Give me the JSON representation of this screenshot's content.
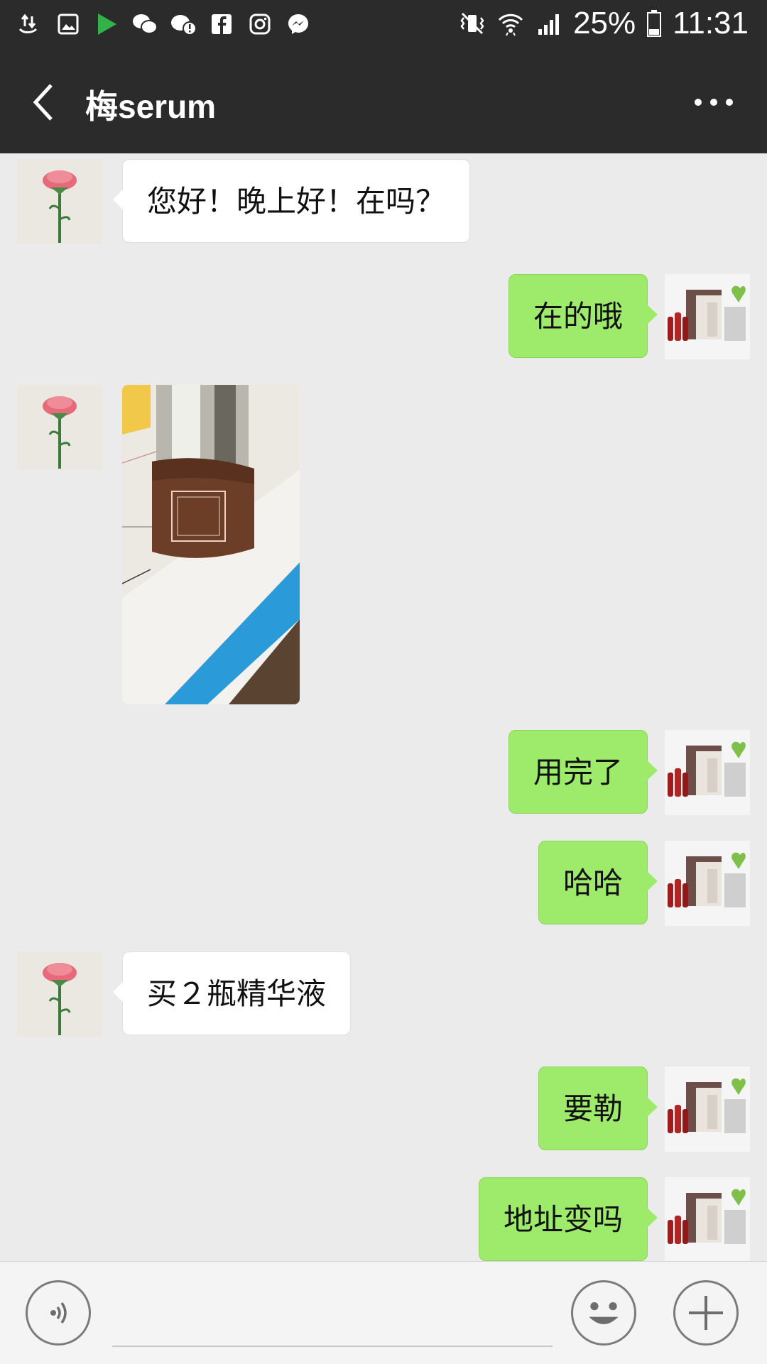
{
  "status_bar": {
    "battery_percent": "25%",
    "time": "11:31",
    "icons": [
      "usb-transfer-icon",
      "gallery-icon",
      "play-store-icon",
      "wechat-icon",
      "wechat-alert-icon",
      "facebook-icon",
      "instagram-icon",
      "messenger-icon",
      "mute-vibrate-icon",
      "wifi-icon",
      "signal-icon",
      "battery-icon"
    ]
  },
  "nav": {
    "title": "梅serum",
    "back_icon": "chevron-left-icon",
    "more_icon": "more-dots-icon"
  },
  "messages": [
    {
      "side": "in",
      "type": "text",
      "text": "您好！晚上好！在吗？"
    },
    {
      "side": "out",
      "type": "text",
      "text": "在的哦"
    },
    {
      "side": "in",
      "type": "image",
      "description": "product-bottle-photo"
    },
    {
      "side": "out",
      "type": "text",
      "text": "用完了"
    },
    {
      "side": "out",
      "type": "text",
      "text": "哈哈"
    },
    {
      "side": "in",
      "type": "text",
      "text": "买２瓶精华液"
    },
    {
      "side": "out",
      "type": "text",
      "text": "要勒"
    },
    {
      "side": "out",
      "type": "text",
      "text": "地址变吗"
    }
  ],
  "colors": {
    "header": "#2b2b2b",
    "chat_bg": "#ebebeb",
    "outgoing_bubble": "#9eea6a",
    "incoming_bubble": "#ffffff"
  },
  "input_bar": {
    "voice_icon": "voice-icon",
    "emoji_icon": "emoji-icon",
    "plus_icon": "plus-icon"
  }
}
